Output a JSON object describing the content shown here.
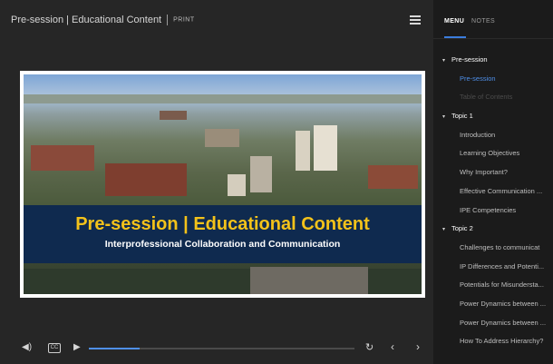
{
  "player": {
    "title": "Pre-session | Educational Content",
    "print_label": "PRINT",
    "slide": {
      "headline": "Pre-session | Educational Content",
      "subtitle": "Interprofessional Collaboration and Communication"
    },
    "controls": {
      "cc_label": "CC",
      "progress": 0.19
    }
  },
  "sidebar": {
    "tabs": [
      {
        "label": "MENU"
      },
      {
        "label": "NOTES"
      }
    ],
    "outline": [
      {
        "type": "section",
        "label": "Pre-session"
      },
      {
        "type": "item",
        "label": "Pre-session",
        "state": "active"
      },
      {
        "type": "item",
        "label": "Table of Contents",
        "state": "disabled"
      },
      {
        "type": "section",
        "label": "Topic 1"
      },
      {
        "type": "item",
        "label": "Introduction",
        "state": "normal"
      },
      {
        "type": "item",
        "label": "Learning Objectives",
        "state": "normal"
      },
      {
        "type": "item",
        "label": "Why Important?",
        "state": "normal"
      },
      {
        "type": "item",
        "label": "Effective Communication ...",
        "state": "normal"
      },
      {
        "type": "item",
        "label": "IPE Competencies",
        "state": "normal"
      },
      {
        "type": "section",
        "label": "Topic 2"
      },
      {
        "type": "item",
        "label": "Challenges to communicat",
        "state": "normal"
      },
      {
        "type": "item",
        "label": "IP Differences and Potenti...",
        "state": "normal"
      },
      {
        "type": "item",
        "label": "Potentials for Misundersta...",
        "state": "normal"
      },
      {
        "type": "item",
        "label": "Power Dynamics between ...",
        "state": "normal"
      },
      {
        "type": "item",
        "label": "Power Dynamics between ...",
        "state": "normal"
      },
      {
        "type": "item",
        "label": "How To Address Hierarchy?",
        "state": "normal"
      }
    ]
  },
  "colors": {
    "accent": "#4f8fe8",
    "banner_bg": "#0f2a4f",
    "banner_title": "#f3c21a"
  }
}
